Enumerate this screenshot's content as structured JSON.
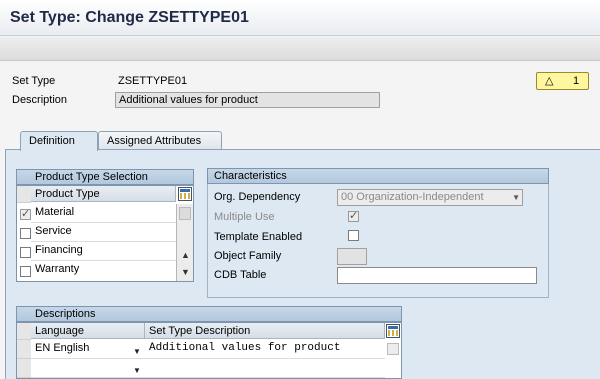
{
  "window": {
    "title": "Set Type: Change ZSETTYPE01"
  },
  "header": {
    "settype_label": "Set Type",
    "settype_value": "ZSETTYPE01",
    "description_label": "Description",
    "description_value": "Additional values for product",
    "messages": {
      "icon": "warning-icon",
      "count": "1"
    }
  },
  "tabs": [
    {
      "label": "Definition",
      "active": true
    },
    {
      "label": "Assigned Attributes",
      "active": false
    }
  ],
  "product_type_selection": {
    "title": "Product Type Selection",
    "column": "Product Type",
    "rows": [
      {
        "label": "Material",
        "checked": true
      },
      {
        "label": "Service",
        "checked": false
      },
      {
        "label": "Financing",
        "checked": false
      },
      {
        "label": "Warranty",
        "checked": false
      }
    ]
  },
  "characteristics": {
    "title": "Characteristics",
    "org_dependency_label": "Org. Dependency",
    "org_dependency_value": "00 Organization-Independent",
    "multiple_use_label": "Multiple Use",
    "multiple_use_checked": true,
    "template_enabled_label": "Template Enabled",
    "template_enabled_checked": false,
    "object_family_label": "Object Family",
    "object_family_value": "",
    "cdb_table_label": "CDB Table",
    "cdb_table_value": ""
  },
  "descriptions": {
    "title": "Descriptions",
    "columns": [
      "Language",
      "Set Type Description"
    ],
    "rows": [
      {
        "language": "EN English",
        "description": "Additional values for product"
      },
      {
        "language": "",
        "description": ""
      }
    ]
  }
}
